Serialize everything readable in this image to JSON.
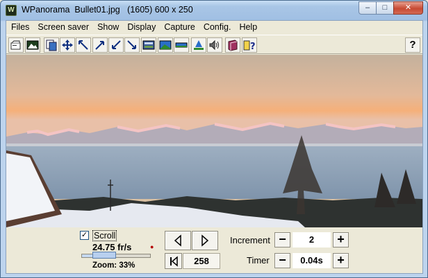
{
  "window": {
    "title": "WPanorama  Bullet01.jpg   (1605) 600 x 250",
    "icon_letter": "W",
    "minimize": "–",
    "maximize": "□",
    "close": "✕"
  },
  "menu": {
    "items": [
      "Files",
      "Screen saver",
      "Show",
      "Display",
      "Capture",
      "Config.",
      "Help"
    ]
  },
  "toolbar": {
    "buttons": [
      "open-file-icon",
      "picture-icon",
      "copy-icon",
      "move-icon",
      "shrink-icon",
      "expand-ne-icon",
      "expand-sw-icon",
      "collapse-se-icon",
      "frame-icon",
      "panorama-icon",
      "strip-icon",
      "tree-icon",
      "sound-icon",
      "book-icon",
      "help-tool-icon"
    ],
    "help_label": "?"
  },
  "controls": {
    "scroll_checked": true,
    "scroll_check_mark": "✓",
    "scroll_label": "Scroll",
    "fps": "24.75 fr/s",
    "fps_icon": "●",
    "zoom_label": "Zoom: 33%",
    "zoom_fraction": 0.33,
    "frame_value": "258",
    "increment_label": "Increment",
    "increment_value": "2",
    "timer_label": "Timer",
    "timer_value": "0.04s",
    "minus": "−",
    "plus": "+"
  },
  "colors": {
    "accent": "#0a246a",
    "close_red": "#c74a33",
    "sky_top": "#c4b19c",
    "sky_glow": "#f5b07a"
  }
}
